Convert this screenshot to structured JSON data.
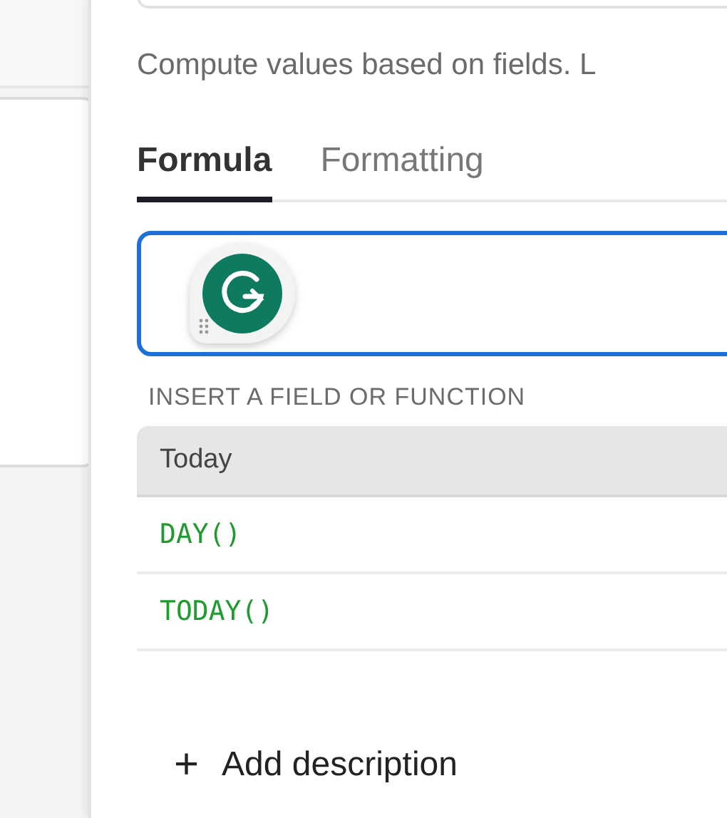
{
  "description": "Compute values based on fields. L",
  "tabs": [
    {
      "label": "Formula",
      "selected": true
    },
    {
      "label": "Formatting",
      "selected": false
    }
  ],
  "formula_field": {
    "focused": true
  },
  "insert_heading": "INSERT A FIELD OR FUNCTION",
  "functions": [
    {
      "kind": "header",
      "label": "Today"
    },
    {
      "kind": "function",
      "label": "DAY()"
    },
    {
      "kind": "function",
      "label": "TODAY()"
    }
  ],
  "add_description": {
    "icon": "+",
    "label": "Add description"
  }
}
